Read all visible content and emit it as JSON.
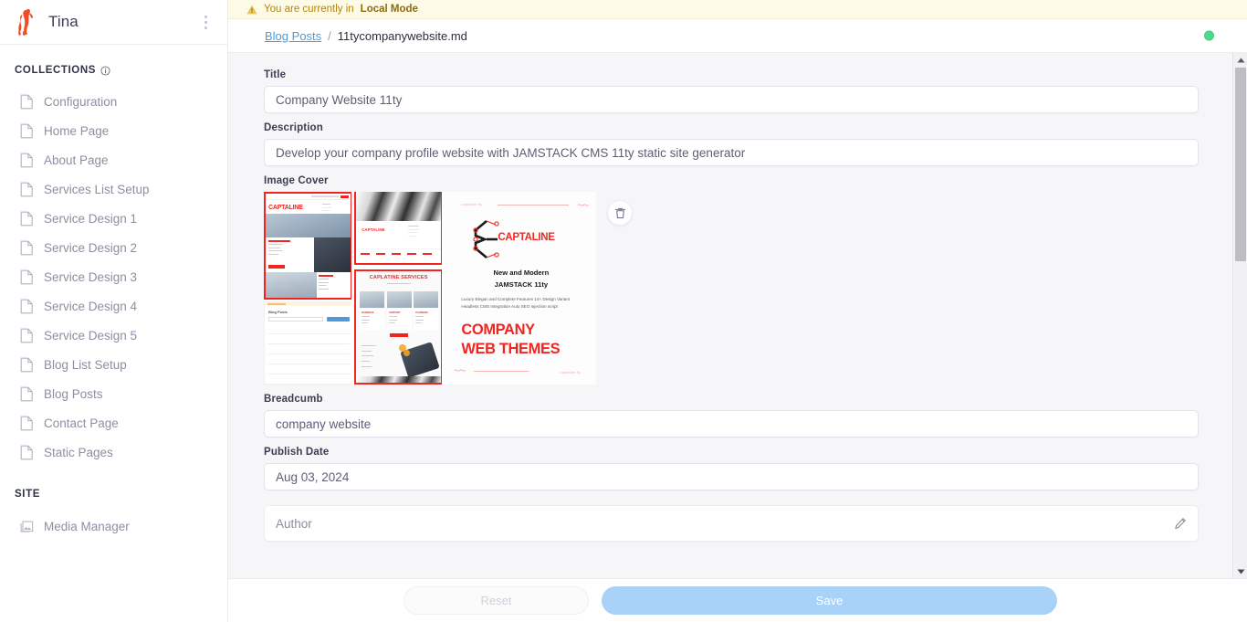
{
  "sidebar": {
    "brand": "Tina",
    "logo_icon": "tina-llama-logo",
    "menu_icon": "kebab-menu-icon",
    "collections_label": "COLLECTIONS",
    "collections_info_icon": "info-icon",
    "collections": [
      {
        "label": "Configuration",
        "icon": "document-icon"
      },
      {
        "label": "Home Page",
        "icon": "document-icon"
      },
      {
        "label": "About Page",
        "icon": "document-icon"
      },
      {
        "label": "Services List Setup",
        "icon": "document-icon"
      },
      {
        "label": "Service Design 1",
        "icon": "document-icon"
      },
      {
        "label": "Service Design 2",
        "icon": "document-icon"
      },
      {
        "label": "Service Design 3",
        "icon": "document-icon"
      },
      {
        "label": "Service Design 4",
        "icon": "document-icon"
      },
      {
        "label": "Service Design 5",
        "icon": "document-icon"
      },
      {
        "label": "Blog List Setup",
        "icon": "document-icon"
      },
      {
        "label": "Blog Posts",
        "icon": "document-icon"
      },
      {
        "label": "Contact Page",
        "icon": "document-icon"
      },
      {
        "label": "Static Pages",
        "icon": "document-icon"
      }
    ],
    "site_label": "SITE",
    "site_items": [
      {
        "label": "Media Manager",
        "icon": "image-icon"
      }
    ]
  },
  "banner": {
    "icon": "warning-triangle-icon",
    "text_prefix": "You are currently in",
    "mode": "Local Mode",
    "background_color": "#fdfbe7",
    "text_color": "#b08410"
  },
  "breadcrumb": {
    "parent": "Blog Posts",
    "separator": "/",
    "current": "11tycompanywebsite.md",
    "status_color": "#4bdb8a"
  },
  "form": {
    "title": {
      "label": "Title",
      "value": "Company Website 11ty"
    },
    "description": {
      "label": "Description",
      "value": "Develop your company profile website with JAMSTACK CMS 11ty static site generator"
    },
    "image_cover": {
      "label": "Image Cover",
      "delete_icon": "trash-icon",
      "poster": {
        "brand": "CAPTALINE",
        "services_heading": "CAPLATINE SERVICES",
        "headline_line1": "New and Modern",
        "headline_line2": "JAMSTACK 11ty",
        "body": "Luxury Elegan and Complete Features 14+ Design Variant Headless CMS Integration Auto SEO injection script",
        "big_line1": "COMPANY",
        "big_line2": "WEB THEMES",
        "watermark_top": "captaline.fly",
        "watermark_bottom": "captaline.fly",
        "blog_posts_label": "Blog Posts",
        "accent_color": "#ee2a23"
      }
    },
    "breadcumb": {
      "label": "Breadcumb",
      "value": "company website"
    },
    "publish_date": {
      "label": "Publish Date",
      "value": "Aug 03, 2024"
    },
    "author": {
      "label": "Author",
      "edit_icon": "pencil-icon"
    }
  },
  "scrollbar": {
    "up_icon": "scroll-up-arrow-icon",
    "down_icon": "scroll-down-arrow-icon",
    "thumb": "scroll-thumb"
  },
  "footer": {
    "reset_label": "Reset",
    "save_label": "Save",
    "save_color": "#a9d2f8"
  }
}
